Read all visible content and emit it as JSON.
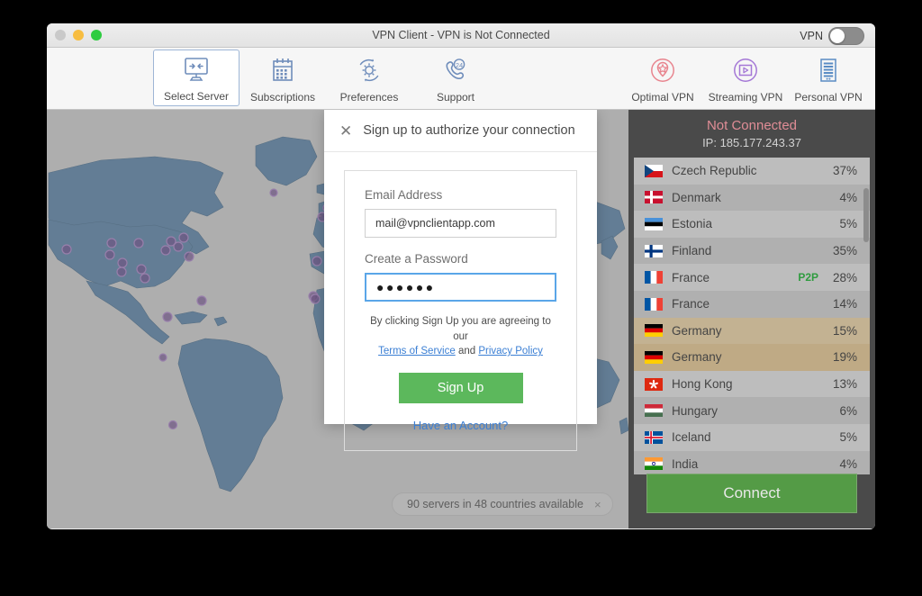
{
  "window": {
    "title": "VPN Client - VPN is Not Connected",
    "traffic_lights": [
      "close-button",
      "minimize-button",
      "maximize-button"
    ],
    "vpn_toggle_label": "VPN",
    "vpn_toggle_state": "off"
  },
  "toolbar": {
    "left_items": [
      {
        "label": "Select Server",
        "icon": "monitor-arrows-icon",
        "active": true
      },
      {
        "label": "Subscriptions",
        "icon": "calendar-icon",
        "active": false
      },
      {
        "label": "Preferences",
        "icon": "gear-icon",
        "active": false
      },
      {
        "label": "Support",
        "icon": "phone-24-icon",
        "active": false
      }
    ],
    "right_items": [
      {
        "label": "Optimal VPN",
        "icon": "pin-star-icon",
        "color": "#e8848e"
      },
      {
        "label": "Streaming VPN",
        "icon": "play-circle-icon",
        "color": "#a477d6"
      },
      {
        "label": "Personal VPN",
        "icon": "document-lines-icon",
        "color": "#5a8cc4"
      }
    ]
  },
  "map": {
    "status_pill_text": "90 servers in 48 countries available",
    "status_pill_close": "×",
    "land_color": "#5d7d9a",
    "ocean_color": "#b9b9b9",
    "marker_color": "#6b4d84"
  },
  "dialog": {
    "close_icon": "✕",
    "title": "Sign up to authorize your connection",
    "email_label": "Email Address",
    "email_value": "mail@vpnclientapp.com",
    "email_placeholder": "Email Address",
    "password_label": "Create a Password",
    "password_value": "●●●●●●",
    "password_placeholder": "Create a Password",
    "terms_prefix": "By clicking Sign Up you are agreeing to our",
    "terms_link": "Terms of Service",
    "terms_and": "and",
    "privacy_link": "Privacy Policy",
    "signup_button": "Sign Up",
    "have_account_link": "Have an Account?",
    "accent_green": "#5cb85c",
    "accent_blue": "#3b7fd4"
  },
  "sidebar": {
    "connection_state": "Not Connected",
    "connection_state_color": "#e08d96",
    "ip_text": "IP: 185.177.243.37",
    "connect_button": "Connect",
    "servers": [
      {
        "country": "Czech Republic",
        "load": "37%",
        "p2p": "",
        "selected": false,
        "flag": "cz"
      },
      {
        "country": "Denmark",
        "load": "4%",
        "p2p": "",
        "selected": false,
        "flag": "dk"
      },
      {
        "country": "Estonia",
        "load": "5%",
        "p2p": "",
        "selected": false,
        "flag": "ee"
      },
      {
        "country": "Finland",
        "load": "35%",
        "p2p": "",
        "selected": false,
        "flag": "fi"
      },
      {
        "country": "France",
        "load": "28%",
        "p2p": "P2P",
        "selected": false,
        "flag": "fr"
      },
      {
        "country": "France",
        "load": "14%",
        "p2p": "",
        "selected": false,
        "flag": "fr"
      },
      {
        "country": "Germany",
        "load": "15%",
        "p2p": "",
        "selected": true,
        "flag": "de"
      },
      {
        "country": "Germany",
        "load": "19%",
        "p2p": "",
        "selected": true,
        "flag": "de"
      },
      {
        "country": "Hong Kong",
        "load": "13%",
        "p2p": "",
        "selected": false,
        "flag": "hk"
      },
      {
        "country": "Hungary",
        "load": "6%",
        "p2p": "",
        "selected": false,
        "flag": "hu"
      },
      {
        "country": "Iceland",
        "load": "5%",
        "p2p": "",
        "selected": false,
        "flag": "is"
      },
      {
        "country": "India",
        "load": "4%",
        "p2p": "",
        "selected": false,
        "flag": "in"
      }
    ]
  }
}
